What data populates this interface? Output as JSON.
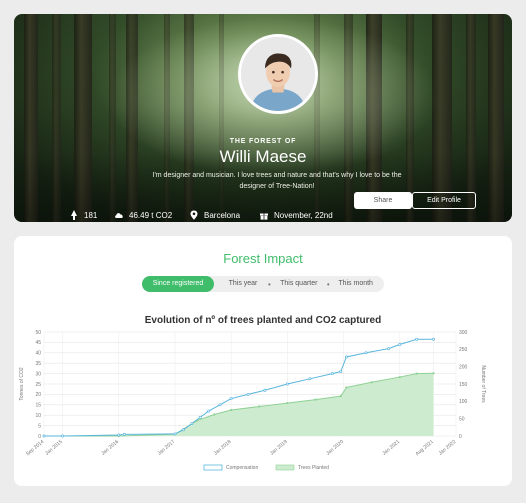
{
  "profile": {
    "subtitle": "THE FOREST OF",
    "name": "Willi Maese",
    "bio": "I'm designer and musician. I love trees and nature and that's why I love to be the designer of Tree-Nation!",
    "stats": {
      "trees": "181",
      "co2": "46.49 t CO2",
      "location": "Barcelona",
      "birthday": "November, 22nd"
    },
    "share_label": "Share",
    "edit_label": "Edit Profile"
  },
  "impact": {
    "title": "Forest Impact",
    "tabs": [
      "Since registered",
      "This year",
      "This quarter",
      "This month"
    ],
    "active_tab": 0
  },
  "colors": {
    "accent": "#3fbd6b",
    "compensation_line": "#5ab6dd",
    "trees_fill": "#cdeccf",
    "trees_line": "#8fd195"
  },
  "chart_data": {
    "type": "line",
    "title": "Evolution of nº of trees planted and CO2 captured",
    "ylabel_left": "Tonnes of CO2",
    "ylabel_right": "Number of Trees",
    "ylim_left": [
      0,
      50
    ],
    "ylim_right": [
      0,
      300
    ],
    "yticks_left": [
      "0",
      "5",
      "10",
      "15",
      "20",
      "25",
      "30",
      "35",
      "40",
      "45",
      "50"
    ],
    "yticks_right": [
      "0",
      "50",
      "100",
      "150",
      "200",
      "250",
      "300"
    ],
    "x_ticks": [
      "Sep 2014",
      "Jan 2015",
      "Jan 2016",
      "Jan 2017",
      "Jan 2018",
      "Jan 2019",
      "Jan 2020",
      "Jan 2021",
      "Aug 2021",
      "Jan 2022"
    ],
    "legend": [
      "Compensation",
      "Trees Planted"
    ],
    "grid": true,
    "legend_position": "bottom",
    "series": [
      {
        "name": "Compensation",
        "axis": "left",
        "x": [
          2014.67,
          2015.0,
          2016.0,
          2016.1,
          2017.0,
          2017.15,
          2017.3,
          2017.45,
          2017.6,
          2017.8,
          2018.0,
          2018.3,
          2018.6,
          2019.0,
          2019.4,
          2019.8,
          2019.95,
          2020.05,
          2020.4,
          2020.8,
          2021.0,
          2021.3,
          2021.6
        ],
        "y": [
          0,
          0,
          0.5,
          0.8,
          1.0,
          3,
          6,
          9,
          12,
          15,
          18,
          20,
          22,
          25,
          27.5,
          30,
          31,
          38,
          40,
          42,
          44,
          46.5,
          46.49
        ]
      },
      {
        "name": "Trees Planted",
        "axis": "right",
        "x": [
          2014.67,
          2015.0,
          2016.0,
          2017.0,
          2017.15,
          2017.4,
          2017.7,
          2018.0,
          2018.5,
          2019.0,
          2019.5,
          2019.95,
          2020.05,
          2020.5,
          2021.0,
          2021.3,
          2021.6
        ],
        "y": [
          0,
          0,
          0,
          5,
          20,
          45,
          62,
          75,
          85,
          95,
          105,
          115,
          140,
          155,
          170,
          180,
          181
        ]
      }
    ]
  }
}
